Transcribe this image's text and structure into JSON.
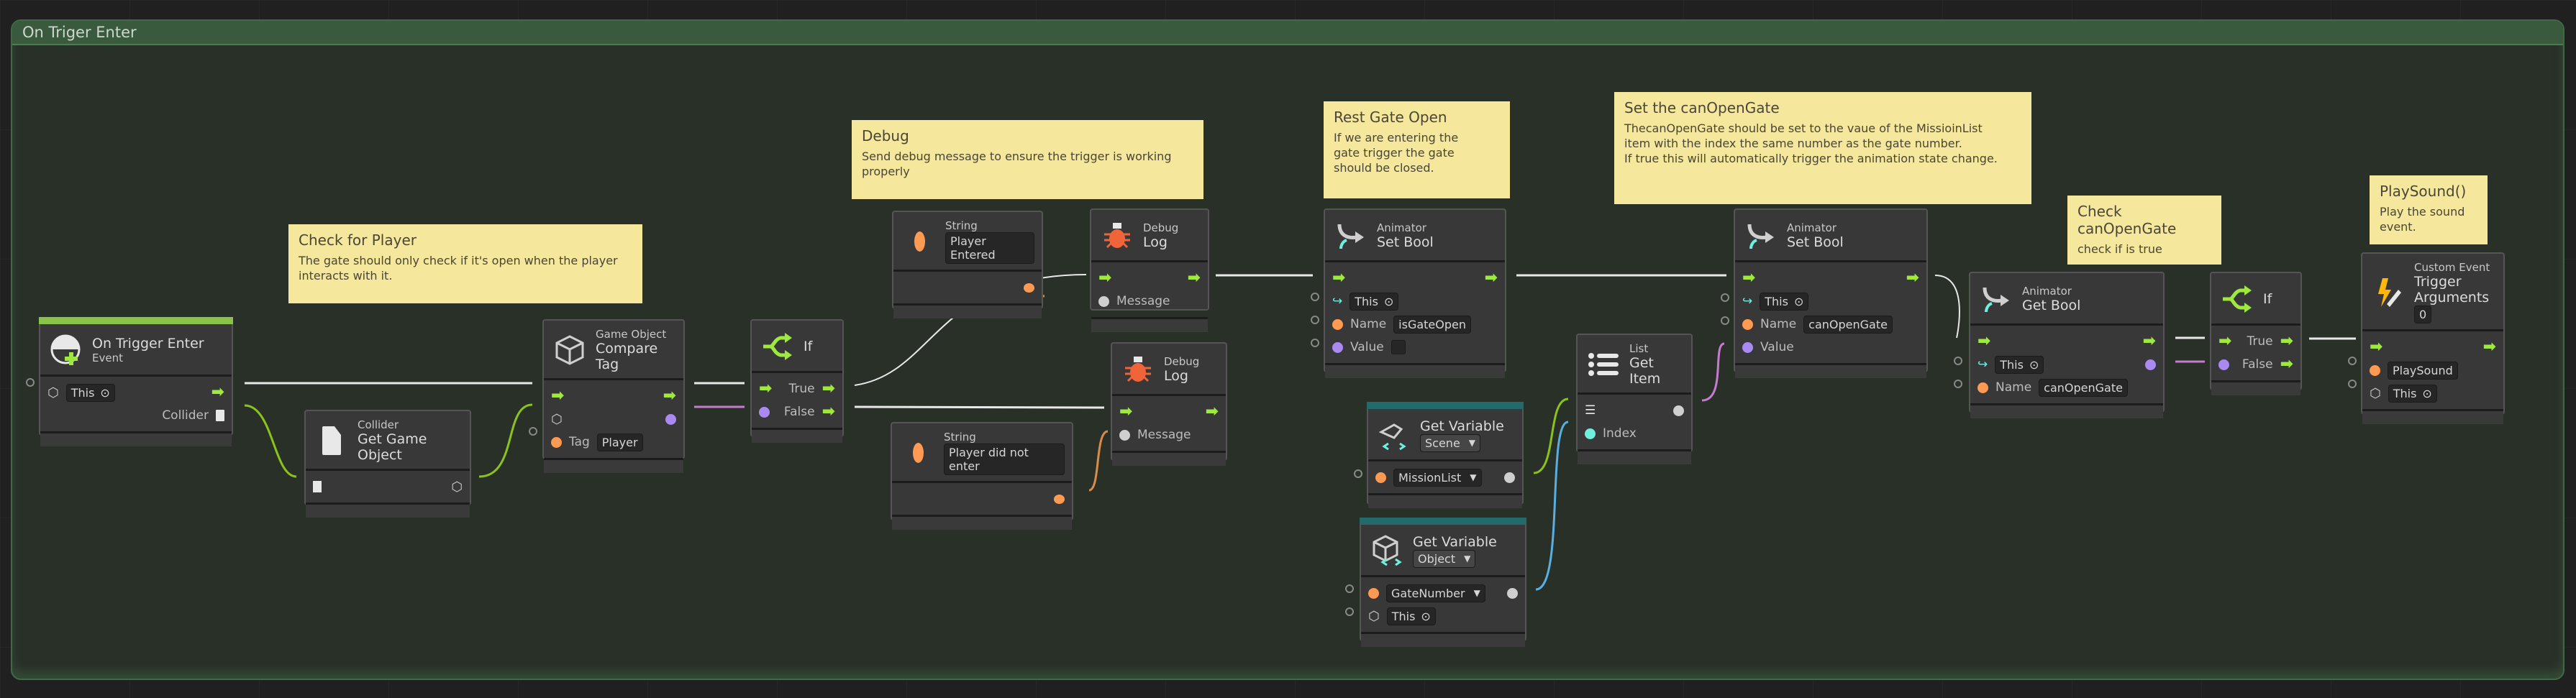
{
  "group": {
    "title": "On Triger Enter"
  },
  "colors": {
    "flow_arrow": "#9ee83f",
    "string_port": "#ff9a52",
    "bool_port": "#a98af0",
    "object_port": "#d0d0d0",
    "int_port": "#6ff0df",
    "sticky_bg": "#f5e79b",
    "event_bar": "#8bc34a",
    "variable_bar": "#236b6b"
  },
  "stickies": [
    {
      "title": "Check for Player",
      "body": "The gate should only check if it's open when the player interacts with it."
    },
    {
      "title": "Debug",
      "body": "Send debug message to ensure the trigger is working properly"
    },
    {
      "title": "Rest Gate Open",
      "body": "If we are entering the\ngate trigger the gate\nshould be closed."
    },
    {
      "title": "Set the canOpenGate",
      "body": "ThecanOpenGate should be set to the vaue of the MissioinList\nitem with the index the same number as the gate number.\nIf true this will automatically trigger the animation state change."
    },
    {
      "title": "Check canOpenGate",
      "body": "check if is true"
    },
    {
      "title": "PlaySound()",
      "body": "Play the sound event."
    }
  ],
  "nodes": {
    "on_trigger_enter": {
      "title": "On Trigger Enter",
      "kind": "Event",
      "target": "This",
      "output": "Collider",
      "icon": "trigger-event-icon"
    },
    "get_game_object": {
      "kind": "Collider",
      "title": "Get Game Object",
      "icon": "collider-icon"
    },
    "compare_tag": {
      "kind": "Game Object",
      "title": "Compare Tag",
      "tag_label": "Tag",
      "tag_value": "Player",
      "icon": "cube-icon"
    },
    "if_1": {
      "title": "If",
      "true_label": "True",
      "false_label": "False",
      "icon": "branch-icon"
    },
    "string_entered": {
      "kind": "String",
      "value": "Player Entered"
    },
    "string_not_entered": {
      "kind": "String",
      "value": "Player did not enter"
    },
    "debug_log_1": {
      "kind": "Debug",
      "title": "Log",
      "message_label": "Message",
      "icon": "bug-icon"
    },
    "debug_log_2": {
      "kind": "Debug",
      "title": "Log",
      "message_label": "Message",
      "icon": "bug-icon"
    },
    "set_bool_1": {
      "kind": "Animator",
      "title": "Set Bool",
      "target": "This",
      "name_label": "Name",
      "name_value": "isGateOpen",
      "value_label": "Value",
      "value_checked": false,
      "icon": "animator-icon"
    },
    "get_var_scene": {
      "title": "Get Variable",
      "scope": "Scene",
      "variable": "MissionList",
      "icon": "scene-variable-icon"
    },
    "get_var_object": {
      "title": "Get Variable",
      "scope": "Object",
      "variable": "GateNumber",
      "target": "This",
      "icon": "object-variable-icon"
    },
    "list_get_item": {
      "kind": "List",
      "title": "Get Item",
      "index_label": "Index",
      "icon": "list-icon"
    },
    "set_bool_2": {
      "kind": "Animator",
      "title": "Set Bool",
      "target": "This",
      "name_label": "Name",
      "name_value": "canOpenGate",
      "value_label": "Value",
      "icon": "animator-icon"
    },
    "get_bool": {
      "kind": "Animator",
      "title": "Get Bool",
      "target": "This",
      "name_label": "Name",
      "name_value": "canOpenGate",
      "icon": "animator-icon"
    },
    "if_2": {
      "title": "If",
      "true_label": "True",
      "false_label": "False",
      "icon": "branch-icon"
    },
    "custom_event": {
      "kind": "Custom Event",
      "title": "Trigger",
      "args_label": "Arguments",
      "args_value": "0",
      "event_name": "PlaySound",
      "target": "This",
      "icon": "custom-event-icon"
    }
  }
}
